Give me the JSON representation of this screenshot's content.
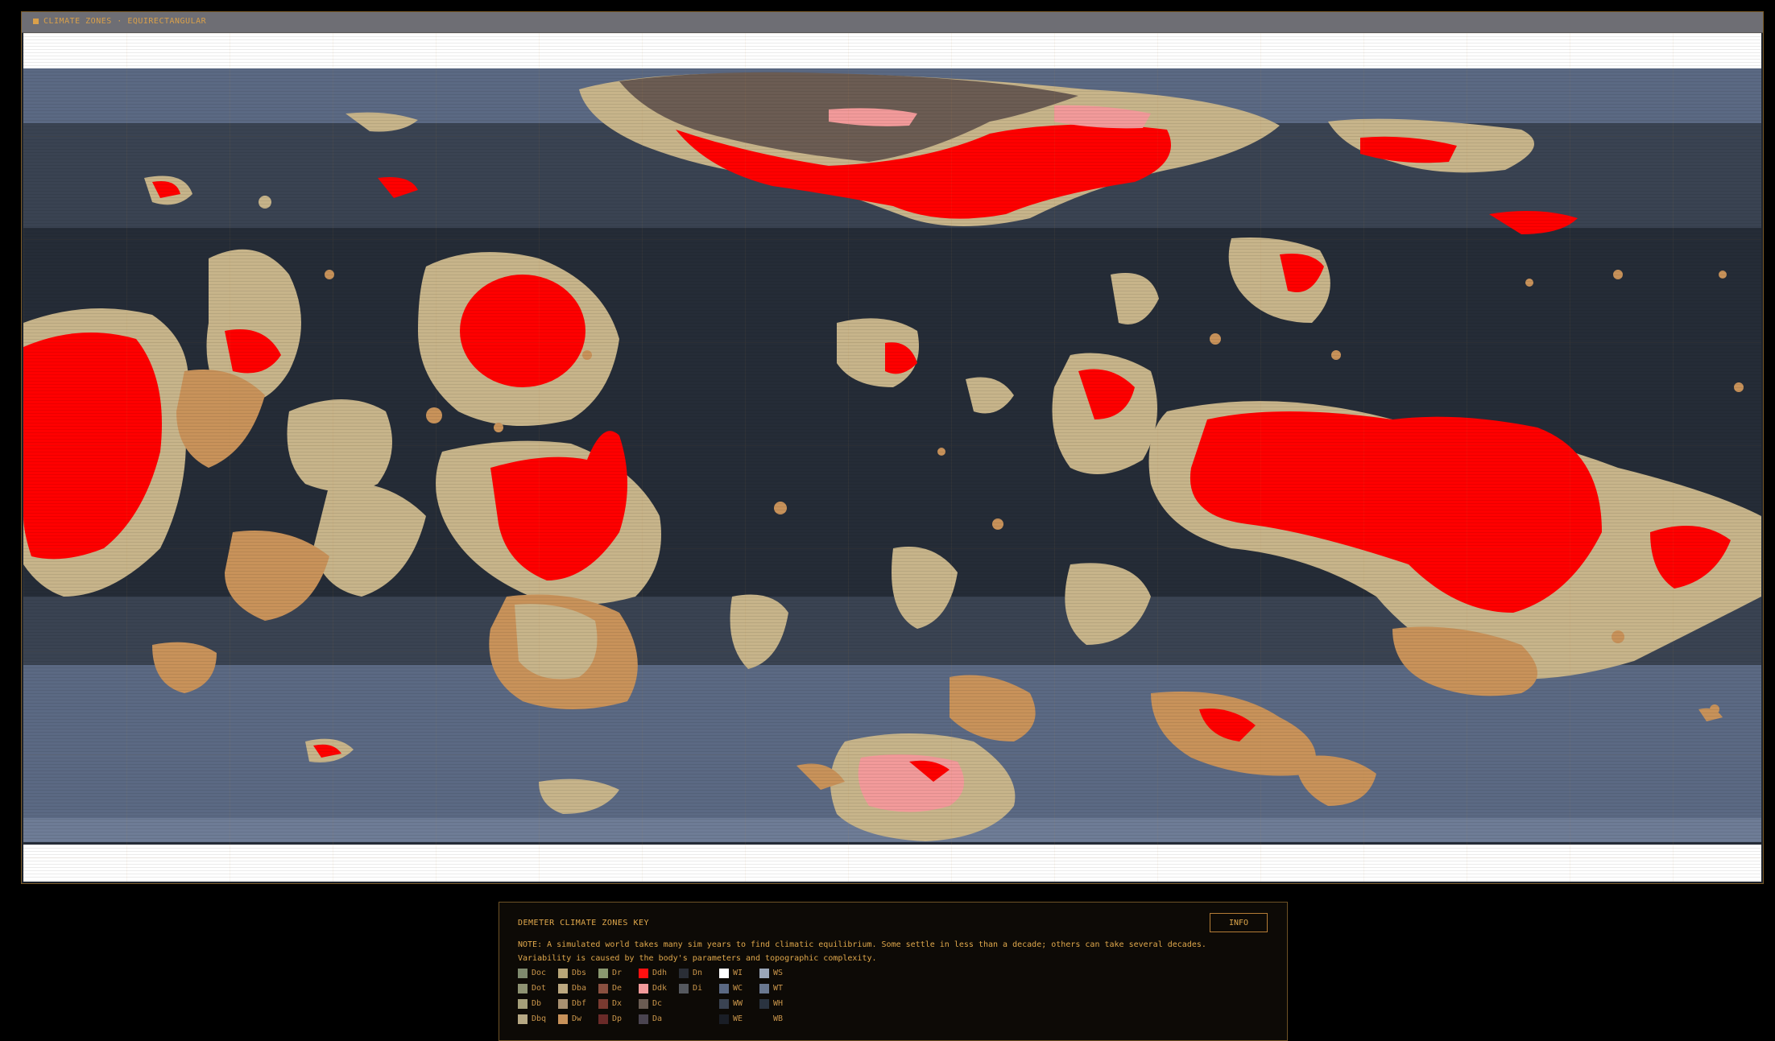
{
  "map": {
    "title": "CLIMATE ZONES · EQUIRECTANGULAR",
    "status": "",
    "zoom": "",
    "colors": {
      "ocean_deep": "#252c37",
      "ocean_mid": "#3a4352",
      "ocean_light": "#5b6983",
      "polar_ice": "#ffffff",
      "desert_hot": "#ff0000",
      "steppe": "#c7b48a",
      "dry": "#c8925a",
      "grass": "#a8a77c",
      "tundra": "#6b5c53",
      "pink": "#f29a9a"
    }
  },
  "key": {
    "title": "DEMETER CLIMATE ZONES KEY",
    "info_button": "INFO",
    "note": "NOTE: A simulated world takes many sim years to find climatic equilibrium. Some settle in less than a decade; others can take several decades. Variability is caused by the body's parameters and topographic complexity.",
    "columns": [
      [
        {
          "label": "Doc",
          "color": "#7f8a6e"
        },
        {
          "label": "Dot",
          "color": "#8e9272"
        },
        {
          "label": "Db",
          "color": "#a59f7a"
        },
        {
          "label": "Dbq",
          "color": "#b6a884"
        }
      ],
      [
        {
          "label": "Dbs",
          "color": "#b8a678"
        },
        {
          "label": "Dba",
          "color": "#bca880"
        },
        {
          "label": "Dbf",
          "color": "#a89070"
        },
        {
          "label": "Dw",
          "color": "#c8925a"
        }
      ],
      [
        {
          "label": "Dr",
          "color": "#8a9870"
        },
        {
          "label": "De",
          "color": "#8a5040"
        },
        {
          "label": "Dx",
          "color": "#7a3a30"
        },
        {
          "label": "Dp",
          "color": "#6a2a28"
        }
      ],
      [
        {
          "label": "Ddh",
          "color": "#ff1010"
        },
        {
          "label": "Ddk",
          "color": "#f29a9a"
        },
        {
          "label": "Dc",
          "color": "#6b5c53"
        },
        {
          "label": "Da",
          "color": "#4a4450"
        }
      ],
      [
        {
          "label": "Dn",
          "color": "#2a2e36"
        },
        {
          "label": "Di",
          "color": "#55585e"
        }
      ],
      [
        {
          "label": "WI",
          "color": "#ffffff"
        },
        {
          "label": "WC",
          "color": "#5b6983"
        },
        {
          "label": "WW",
          "color": "#3a4352"
        },
        {
          "label": "WE",
          "color": "#1a1e26"
        }
      ],
      [
        {
          "label": "WS",
          "color": "#9aa6b8"
        },
        {
          "label": "WT",
          "color": "#6a7890"
        },
        {
          "label": "WH",
          "color": "#2a3340"
        },
        {
          "label": "WB",
          "color": "#0d0a06"
        }
      ]
    ]
  }
}
